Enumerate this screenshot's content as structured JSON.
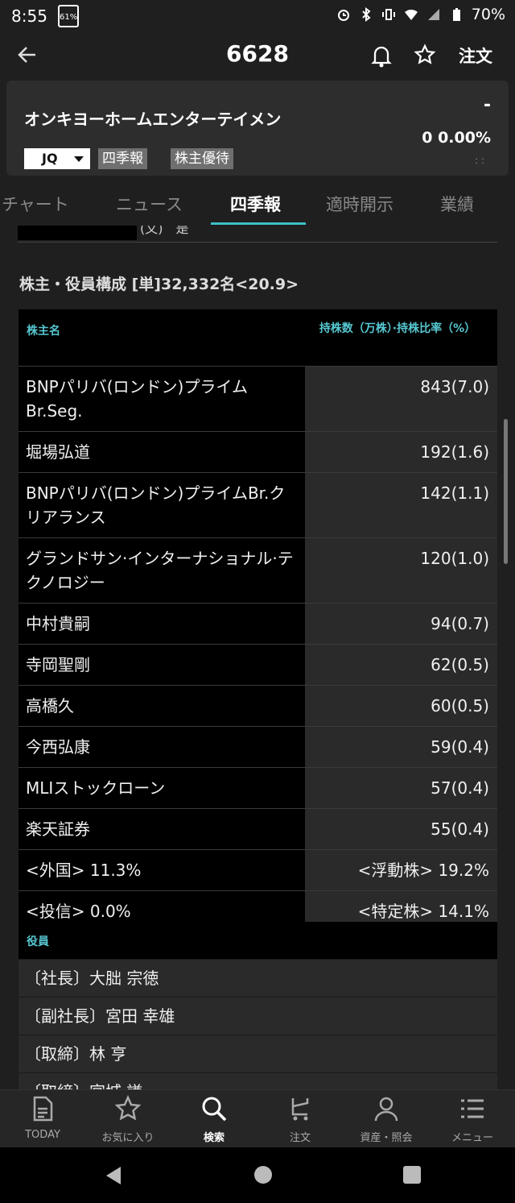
{
  "status": {
    "time": "8:55",
    "notification": "61%",
    "battery": "70%"
  },
  "header": {
    "title": "6628",
    "order_label": "注文"
  },
  "stock": {
    "name": "オンキヨーホームエンターテイメン",
    "price": "-",
    "change": "0  0.00%",
    "market": "JQ",
    "tags": [
      "四季報",
      "株主優待"
    ]
  },
  "tabs": [
    "チャート",
    "ニュース",
    "四季報",
    "適時開示",
    "業績"
  ],
  "active_tab": "四季報",
  "prev_text": "(文)　是",
  "shareholders": {
    "title": "株主・役員構成 [単]32,332名<20.9>",
    "col_name": "株主名",
    "col_value": "持株数（万株）·持株比率（%）",
    "rows": [
      {
        "name": "BNPパリバ(ロンドン)プライムBr.Seg.",
        "value": "843(7.0)"
      },
      {
        "name": "堀場弘道",
        "value": "192(1.6)"
      },
      {
        "name": "BNPパリバ(ロンドン)プライムBr.クリアランス",
        "value": "142(1.1)"
      },
      {
        "name": "グランドサン·インターナショナル·テクノロジー",
        "value": "120(1.0)"
      },
      {
        "name": "中村貴嗣",
        "value": "94(0.7)"
      },
      {
        "name": "寺岡聖剛",
        "value": "62(0.5)"
      },
      {
        "name": "高橋久",
        "value": "60(0.5)"
      },
      {
        "name": "今西弘康",
        "value": "59(0.4)"
      },
      {
        "name": "MLIストックローン",
        "value": "57(0.4)"
      },
      {
        "name": "楽天証券",
        "value": "55(0.4)"
      },
      {
        "name": "<外国> 11.3%",
        "value": "<浮動株> 19.2%"
      },
      {
        "name": "<投信> 0.0%",
        "value": "<特定株> 14.1%"
      }
    ]
  },
  "officers": {
    "title": "役員",
    "rows": [
      "〔社長〕大朏 宗徳",
      "〔副社長〕宮田 幸雄",
      "〔取締〕林 亨",
      "〔取締〕宮城 謙"
    ]
  },
  "bottom_nav": [
    {
      "label": "TODAY",
      "icon": "document-icon"
    },
    {
      "label": "お気に入り",
      "icon": "star-icon"
    },
    {
      "label": "検索",
      "icon": "search-icon"
    },
    {
      "label": "注文",
      "icon": "cart-icon"
    },
    {
      "label": "資産・照会",
      "icon": "person-icon"
    },
    {
      "label": "メニュー",
      "icon": "menu-icon"
    }
  ],
  "colors": {
    "accent": "#3fbfc9",
    "header_text": "#56c7d0"
  }
}
